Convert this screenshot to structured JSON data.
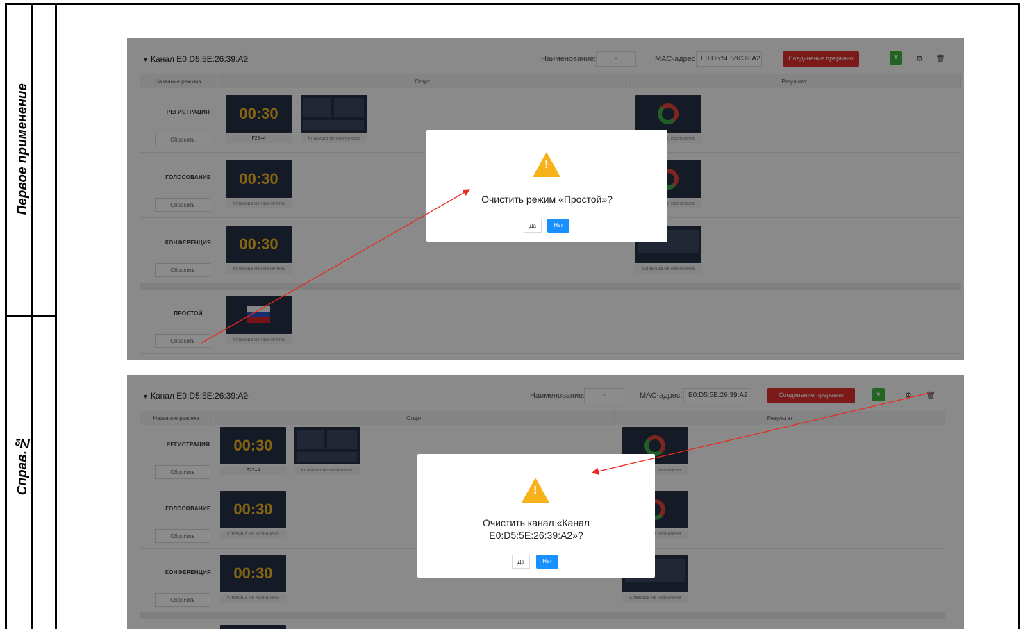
{
  "side_labels": {
    "top": "Первое применение",
    "bottom": "Справ.№"
  },
  "screens": [
    {
      "channel_title": "Канал E0:D5:5E:26:39:A2",
      "name_label": "Наименование:",
      "name_value": "-",
      "mac_label": "MAC-адрес:",
      "mac_value": "E0:D5:5E:26:39:A2",
      "status": "Соединение прервано",
      "columns": {
        "mode": "Название режима",
        "start": "Старт",
        "result": "Результат"
      },
      "rows": [
        {
          "name": "РЕГИСТРАЦИЯ",
          "reset": "Сбросить",
          "timer": "00:30",
          "start_caption": "F22=4",
          "extra_caption": "Клавиша не назначена",
          "result_caption": "Клавиша не назначена"
        },
        {
          "name": "ГОЛОСОВАНИЕ",
          "reset": "Сбросить",
          "timer": "00:30",
          "start_caption": "Клавиша не назначена",
          "result_caption": "Клавиша не назначена"
        },
        {
          "name": "КОНФЕРЕНЦИЯ",
          "reset": "Сбросить",
          "timer": "00:30",
          "start_caption": "Клавиша не назначена",
          "result_caption": "Клавиша не назначена"
        },
        {
          "name": "ПРОСТОЙ",
          "reset": "Сбросить",
          "start_caption": "Клавиша не назначена"
        }
      ],
      "dialog": {
        "message": "Очистить режим «Простой»?",
        "yes": "Да",
        "no": "Нет"
      }
    },
    {
      "channel_title": "Канал E0:D5:5E:26:39:A2",
      "name_label": "Наименование:",
      "name_value": "-",
      "mac_label": "MAC-адрес:",
      "mac_value": "E0:D5:5E:26:39:A2",
      "status": "Соединение прервано",
      "columns": {
        "mode": "Название режима",
        "start": "Старт",
        "result": "Результат"
      },
      "rows": [
        {
          "name": "РЕГИСТРАЦИЯ",
          "reset": "Сбросить",
          "timer": "00:30",
          "start_caption": "F22=4",
          "extra_caption": "Клавиша не назначена",
          "result_caption": "Клавиша не назначена"
        },
        {
          "name": "ГОЛОСОВАНИЕ",
          "reset": "Сбросить",
          "timer": "00:30",
          "start_caption": "Клавиша не назначена",
          "result_caption": "Клавиша не назначена"
        },
        {
          "name": "КОНФЕРЕНЦИЯ",
          "reset": "Сбросить",
          "timer": "00:30",
          "start_caption": "Клавиша не назначена",
          "result_caption": "Клавиша не назначена"
        }
      ],
      "dialog": {
        "message_line1": "Очистить канал «Канал",
        "message_line2": "E0:D5:5E:26:39:A2»?",
        "yes": "Да",
        "no": "Нет"
      }
    }
  ],
  "colors": {
    "status_red": "#e0312e",
    "accent_blue": "#1890ff",
    "warning_yellow": "#f7b21b",
    "timer_yellow": "#f2b81f",
    "tile_navy": "#273048",
    "arrow_red": "#e8291f"
  }
}
